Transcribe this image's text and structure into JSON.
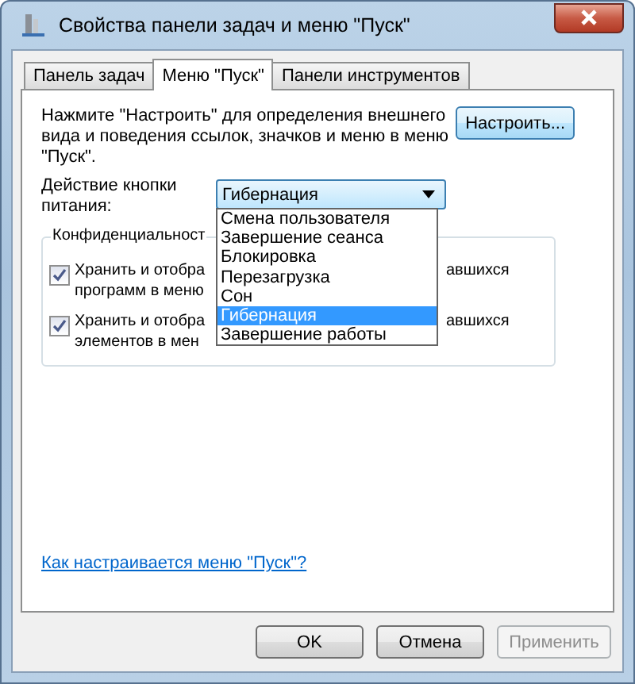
{
  "window": {
    "title": "Свойства панели задач и меню \"Пуск\""
  },
  "tabs": [
    {
      "label": "Панель задач",
      "selected": false
    },
    {
      "label": "Меню \"Пуск\"",
      "selected": true
    },
    {
      "label": "Панели инструментов",
      "selected": false
    }
  ],
  "description": "Нажмите \"Настроить\" для определения внешнего вида и поведения ссылок, значков и меню в меню \"Пуск\".",
  "customize_button": "Настроить...",
  "power_action": {
    "label": "Действие кнопки питания:",
    "value": "Гибернация",
    "expanded": true,
    "options": [
      {
        "label": "Смена пользователя",
        "selected": false
      },
      {
        "label": "Завершение сеанса",
        "selected": false
      },
      {
        "label": "Блокировка",
        "selected": false
      },
      {
        "label": "Перезагрузка",
        "selected": false
      },
      {
        "label": "Сон",
        "selected": false
      },
      {
        "label": "Гибернация",
        "selected": true
      },
      {
        "label": "Завершение работы",
        "selected": false
      }
    ]
  },
  "privacy": {
    "title": "Конфиденциальност",
    "checkboxes": [
      {
        "text_left": "Хранить и отобра\nпрограмм в меню",
        "text_right": "авшихся",
        "checked": true
      },
      {
        "text_left": "Хранить и отобра\nэлементов в мен",
        "text_right": "авшихся",
        "checked": true
      }
    ]
  },
  "help_link": "Как настраивается меню \"Пуск\"?",
  "buttons": [
    {
      "label": "OK",
      "disabled": false
    },
    {
      "label": "Отмена",
      "disabled": false
    },
    {
      "label": "Применить",
      "disabled": true
    }
  ]
}
